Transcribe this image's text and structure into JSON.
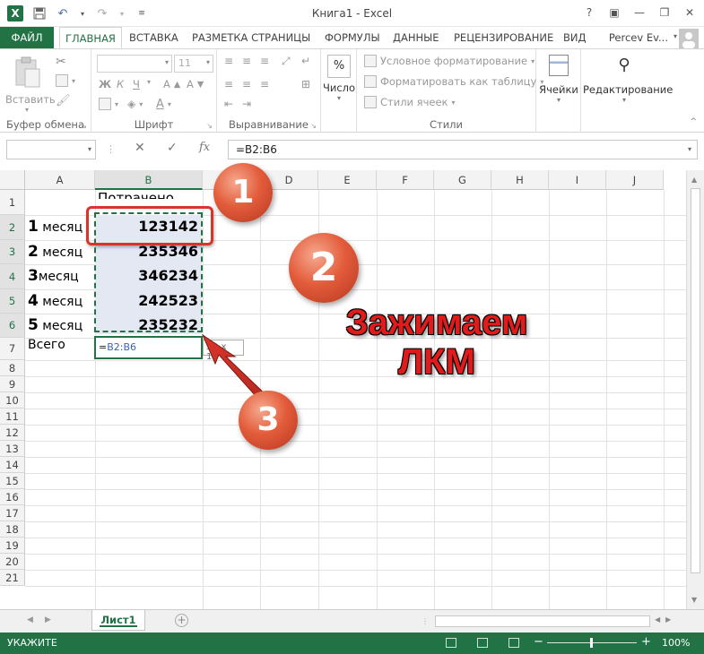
{
  "window": {
    "title": "Книга1 - Excel"
  },
  "qat": {
    "save": "💾",
    "undo": "↶",
    "redo": "↷"
  },
  "tabs": [
    {
      "label": "ФАЙЛ"
    },
    {
      "label": "ГЛАВНАЯ"
    },
    {
      "label": "ВСТАВКА"
    },
    {
      "label": "РАЗМЕТКА СТРАНИЦЫ"
    },
    {
      "label": "ФОРМУЛЫ"
    },
    {
      "label": "ДАННЫЕ"
    },
    {
      "label": "РЕЦЕНЗИРОВАНИЕ"
    },
    {
      "label": "ВИД"
    }
  ],
  "account": {
    "name": "Percev Ev..."
  },
  "ribbon": {
    "clipboard": {
      "paste": "Вставить",
      "group": "Буфер обмена"
    },
    "font": {
      "size": "11",
      "bold": "Ж",
      "italic": "К",
      "underline": "Ч",
      "group": "Шрифт"
    },
    "alignment": {
      "group": "Выравнивание"
    },
    "number": {
      "label": "Число",
      "icon": "%"
    },
    "styles": {
      "cond": "Условное форматирование",
      "table": "Форматировать как таблицу",
      "cell": "Стили ячеек",
      "group": "Стили"
    },
    "cells": {
      "label": "Ячейки"
    },
    "editing": {
      "label": "Редактирование"
    }
  },
  "formula_bar": {
    "name_box": "",
    "fx": "fx",
    "formula": "=B2:B6"
  },
  "columns": [
    "A",
    "B",
    "C",
    "D",
    "E",
    "F",
    "G",
    "H",
    "I",
    "J"
  ],
  "rows": [
    "1",
    "2",
    "3",
    "4",
    "5",
    "6",
    "7",
    "8",
    "9",
    "10",
    "11",
    "12",
    "13",
    "14",
    "15",
    "16",
    "17",
    "18",
    "19",
    "20",
    "21"
  ],
  "cells": {
    "b1": "Потрачено",
    "data": [
      {
        "num": "1",
        "word": "месяц",
        "value": "123142"
      },
      {
        "num": "2",
        "word": "месяц",
        "value": "235346"
      },
      {
        "num": "3",
        "word": "месяц",
        "value": "346234"
      },
      {
        "num": "4",
        "word": "месяц",
        "value": "242523"
      },
      {
        "num": "5",
        "word": "месяц",
        "value": "235232"
      }
    ],
    "a7": "Всего",
    "b7_prefix": "=",
    "b7_ref": "B2:B6",
    "tooltip": "5R x 1C"
  },
  "sheet": {
    "tab": "Лист1"
  },
  "status": {
    "mode": "УКАЖИТЕ",
    "zoom": "100%"
  },
  "annotations": {
    "n1": "1",
    "n2": "2",
    "n3": "3",
    "caption_line1": "Зажимаем",
    "caption_line2": "ЛКМ"
  },
  "colors": {
    "excel_green": "#217346",
    "annotation_red": "#e01b1b",
    "selection": "#e3e8f3"
  }
}
